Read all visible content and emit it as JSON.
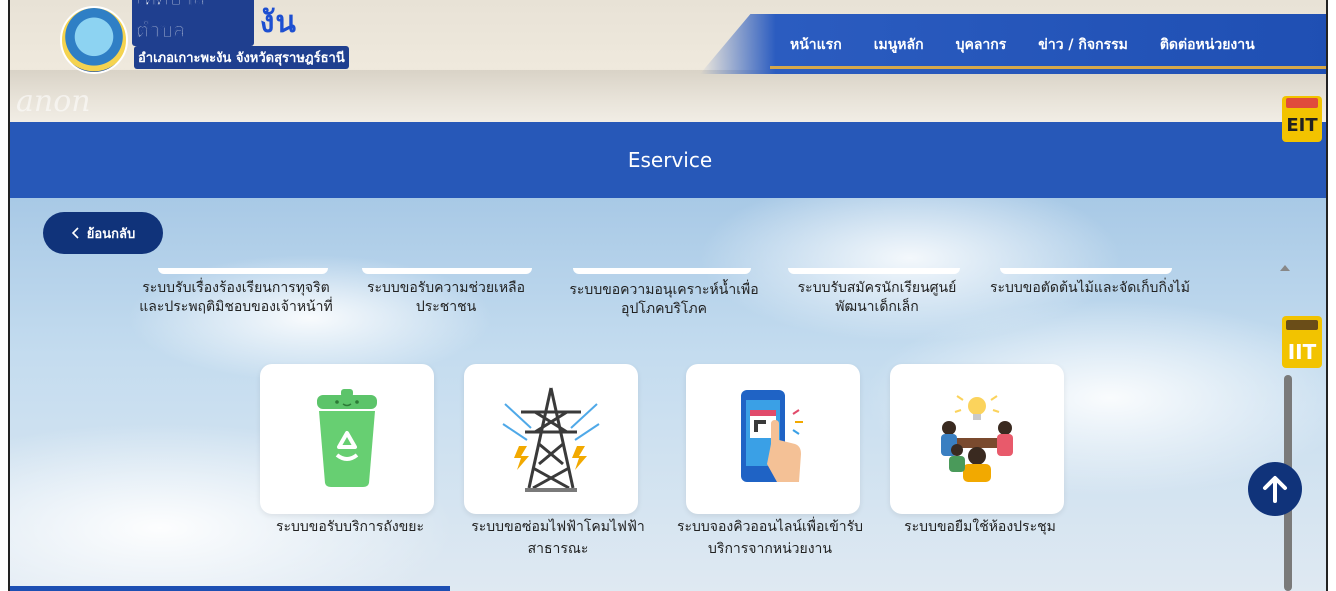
{
  "header": {
    "logo_title_prefix": "เทศบาลตำบล",
    "logo_title_name": "เพชรพะงัน",
    "logo_subtitle": "อำเภอเกาะพะงัน จังหวัดสุราษฎร์ธานี",
    "watermark": "anon",
    "nav": [
      "หน้าแรก",
      "เมนูหลัก",
      "บุคลากร",
      "ข่าว / กิจกรรม",
      "ติดต่อหน่วยงาน"
    ]
  },
  "badges": {
    "eit": "EIT",
    "iit": "IIT"
  },
  "page_title": "Eservice",
  "back_button": {
    "icon": "chevron-left-icon",
    "label": "ย้อนกลับ"
  },
  "row1_services": [
    {
      "label": "ระบบรับเรื่องร้องเรียนการทุจริตและประพฤติมิชอบของเจ้าหน้าที่"
    },
    {
      "label": "ระบบขอรับความช่วยเหลือประชาชน"
    },
    {
      "label": "ระบบขอความอนุเคราะห์น้ำเพื่ออุปโภคบริโภค"
    },
    {
      "label": "ระบบรับสมัครนักเรียนศูนย์พัฒนาเด็กเล็ก"
    },
    {
      "label": "ระบบขอตัดต้นไม้และจัดเก็บกิ่งไม้"
    }
  ],
  "row2_services": [
    {
      "label": "ระบบขอรับบริการถังขยะ",
      "icon": "recycle-bin-icon"
    },
    {
      "label": "ระบบขอซ่อมไฟฟ้าโคมไฟฟ้าสาธารณะ",
      "icon": "power-tower-icon"
    },
    {
      "label": "ระบบจองคิวออนไลน์เพื่อเข้ารับบริการจากหน่วยงาน",
      "icon": "phone-calendar-icon"
    },
    {
      "label": "ระบบขอยืมใช้ห้องประชุม",
      "icon": "meeting-room-icon"
    }
  ],
  "colors": {
    "brand": "#2758b8",
    "dark_button": "#10337a",
    "accent_gold": "#d6a84a"
  }
}
